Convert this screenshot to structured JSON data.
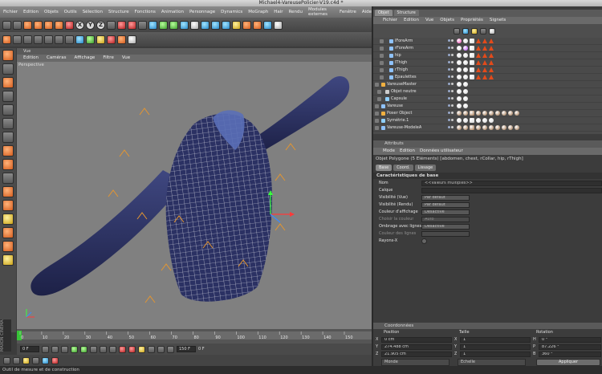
{
  "window": {
    "title": "Michael4-VareusePolicier-V19.c4d *"
  },
  "menubar": [
    "Fichier",
    "Edition",
    "Objets",
    "Outils",
    "Sélection",
    "Structure",
    "Fonctions",
    "Animation",
    "Personnage",
    "Dynamics",
    "MoGraph",
    "Hair",
    "Rendu",
    "Modules externes",
    "Fenêtre",
    "Aide"
  ],
  "toolbar": {
    "axis_x": "X",
    "axis_y": "Y",
    "axis_z": "Z"
  },
  "viewport": {
    "panel_title": "Vue",
    "menu": [
      "Edition",
      "Caméras",
      "Affichage",
      "Filtre",
      "Vue"
    ],
    "camera_label": "Perspective"
  },
  "timeline": {
    "ticks": [
      "0",
      "10",
      "20",
      "30",
      "40",
      "50",
      "60",
      "70",
      "80",
      "90",
      "100",
      "110",
      "120",
      "130",
      "140",
      "150"
    ],
    "current_frame": "0",
    "start_field": "0 F",
    "end_field": "150 F",
    "frame_display": "0 F"
  },
  "side_brand": "MAXON CINEMA 4D",
  "status": {
    "text": "Outil de mesure et de construction"
  },
  "object_manager": {
    "tabs": [
      "Objet",
      "Structure"
    ],
    "menu": [
      "Fichier",
      "Edition",
      "Vue",
      "Objets",
      "Propriétés",
      "Signets"
    ],
    "rows": [
      {
        "name": "lForeArm",
        "indent": 2,
        "icon_color": "#8fc3ff"
      },
      {
        "name": "rForeArm",
        "indent": 2,
        "icon_color": "#8fc3ff"
      },
      {
        "name": "hip",
        "indent": 2,
        "icon_color": "#8fc3ff"
      },
      {
        "name": "lThigh",
        "indent": 2,
        "icon_color": "#8fc3ff"
      },
      {
        "name": "rThigh",
        "indent": 2,
        "icon_color": "#8fc3ff"
      },
      {
        "name": "Epaulettes",
        "indent": 2,
        "icon_color": "#8fc3ff"
      },
      {
        "name": "VareuseMaster",
        "indent": 0,
        "icon_color": "#f0b040"
      },
      {
        "name": "Objet neutre",
        "indent": 1,
        "icon_color": "#cccccc"
      },
      {
        "name": "Capsule",
        "indent": 1,
        "icon_color": "#8fd0ff"
      },
      {
        "name": "Vareuse",
        "indent": 0,
        "icon_color": "#8fc3ff"
      },
      {
        "name": "Poser Object",
        "indent": 0,
        "icon_color": "#f0b040"
      },
      {
        "name": "Symétrie.1",
        "indent": 0,
        "icon_color": "#8fd0ff"
      },
      {
        "name": "Vareuse-ModeleA",
        "indent": 0,
        "icon_color": "#8fc3ff"
      }
    ]
  },
  "attributes": {
    "panel_title": "Attributs",
    "menu": [
      "Mode",
      "Edition",
      "Données utilisateur"
    ],
    "object_line": "Objet Polygone (5 Eléments) [abdomen, chest, rCollar, hip, rThigh]",
    "tabs": [
      "Base",
      "Coord.",
      "Lissage"
    ],
    "section": "Caractéristiques de base",
    "props": [
      {
        "label": "Nom",
        "value": "<<Valeurs multiples>>",
        "kind": "field"
      },
      {
        "label": "Calque",
        "value": "",
        "kind": "field"
      },
      {
        "label": "Visibilité (Vue)",
        "value": "Par défaut",
        "kind": "select"
      },
      {
        "label": "Visibilité (Rendu)",
        "value": "Par défaut",
        "kind": "select"
      },
      {
        "label": "Couleur d'affichage",
        "value": "Désactivé",
        "kind": "select"
      },
      {
        "label": "Choisir la couleur",
        "value": "Auto",
        "kind": "dim"
      },
      {
        "label": "Ombrage avec lignes",
        "value": "Désactivé",
        "kind": "select"
      },
      {
        "label": "Couleur des lignes",
        "value": "",
        "kind": "dim"
      },
      {
        "label": "Rayons-X",
        "value": "",
        "kind": "check"
      }
    ]
  },
  "coordinates": {
    "panel_title": "Coordonnées",
    "headers": [
      "Position",
      "Taille",
      "Rotation"
    ],
    "rows": [
      {
        "axis": "X",
        "position": "0 cm",
        "size_axis": "X",
        "size": "1",
        "rot_axis": "H",
        "rotation": "0 °"
      },
      {
        "axis": "Y",
        "position": "274.488 cm",
        "size_axis": "Y",
        "size": "1",
        "rot_axis": "P",
        "rotation": "87.226 °"
      },
      {
        "axis": "Z",
        "position": "21.905 cm",
        "size_axis": "Z",
        "size": "1",
        "rot_axis": "B",
        "rotation": "360 °"
      }
    ],
    "mode_left": "Monde",
    "mode_right": "Echelle",
    "apply": "Appliquer"
  }
}
